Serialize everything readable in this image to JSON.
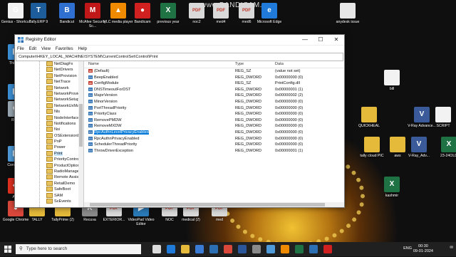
{
  "recording_watermark": "www.BANDICAM.com",
  "desktop_icons": [
    {
      "label": "Genius - Shortcut",
      "icon": "genius-icon",
      "color": "#f2f2f2"
    },
    {
      "label": "Tally.ERP 9",
      "icon": "tally-icon",
      "color": "#1d5d9b"
    },
    {
      "label": "Bandicut",
      "icon": "bandicut-icon",
      "color": "#2f6fd0"
    },
    {
      "label": "McAfee Security Sc...",
      "icon": "mcafee-icon",
      "color": "#c01818"
    },
    {
      "label": "VLC media player",
      "icon": "vlc-icon",
      "color": "#f08a00"
    },
    {
      "label": "Bandicam",
      "icon": "bandicam-icon",
      "color": "#d02020"
    },
    {
      "label": "previous year",
      "icon": "excel-icon",
      "color": "#1f7244"
    },
    {
      "label": "noc2",
      "icon": "pdf-icon",
      "color": "#d9d9d9"
    },
    {
      "label": "med4",
      "icon": "pdf-icon",
      "color": "#d9d9d9"
    },
    {
      "label": "med6",
      "icon": "pdf-icon",
      "color": "#d9d9d9"
    },
    {
      "label": "Microsoft Edge",
      "icon": "edge-icon",
      "color": "#1f7ad9"
    },
    {
      "label": "anydesk issue",
      "icon": "file-icon",
      "color": "#e6e6e6"
    },
    {
      "label": "This PC",
      "icon": "pc-icon",
      "color": "#3c8fd6"
    },
    {
      "label": "Netw",
      "icon": "network-icon",
      "color": "#3c8fd6"
    },
    {
      "label": "Recy",
      "icon": "recycle-icon",
      "color": "#9aa8b3"
    },
    {
      "label": "Contr Pan",
      "icon": "control-panel-icon",
      "color": "#4f9bd9"
    },
    {
      "label": "Any",
      "icon": "anydesk-icon",
      "color": "#e03020"
    },
    {
      "label": "bill",
      "icon": "file-icon",
      "color": "#f2f2f2"
    },
    {
      "label": "QUICKHEAL",
      "icon": "folder-icon",
      "color": "#e5b93a"
    },
    {
      "label": "V-Ray Advance...",
      "icon": "vray-icon",
      "color": "#3a5a9a"
    },
    {
      "label": "SCRIPT",
      "icon": "file-icon",
      "color": "#f2f2f2"
    },
    {
      "label": "tally cloud PIC",
      "icon": "folder-icon",
      "color": "#e5b93a"
    },
    {
      "label": "aws",
      "icon": "folder-icon",
      "color": "#e5b93a"
    },
    {
      "label": "V-Ray_Adv...",
      "icon": "vray-icon",
      "color": "#3a5a9a"
    },
    {
      "label": "23-24OLD",
      "icon": "excel-icon",
      "color": "#1f7244"
    },
    {
      "label": "kashmir",
      "icon": "excel-icon",
      "color": "#1f7244"
    },
    {
      "label": "Google Chrome",
      "icon": "chrome-icon",
      "color": "#d9483b"
    },
    {
      "label": "TALLY",
      "icon": "folder-icon",
      "color": "#e5b93a"
    },
    {
      "label": "TallyPrime (2)",
      "icon": "folder-icon",
      "color": "#e5b93a"
    },
    {
      "label": "Recuva",
      "icon": "recuva-icon",
      "color": "#8a8a8a"
    },
    {
      "label": "EXTERIOR...",
      "icon": "pdf-icon",
      "color": "#d9d9d9"
    },
    {
      "label": "VideoPad Video Editor",
      "icon": "videopad-icon",
      "color": "#2a7ab8"
    },
    {
      "label": "NOC",
      "icon": "pdf-icon",
      "color": "#d9d9d9"
    },
    {
      "label": "medical (2)",
      "icon": "pdf-icon",
      "color": "#d9d9d9"
    },
    {
      "label": "med",
      "icon": "pdf-icon",
      "color": "#d9d9d9"
    }
  ],
  "window": {
    "title": "Registry Editor",
    "menu": [
      "File",
      "Edit",
      "View",
      "Favorites",
      "Help"
    ],
    "address": "Computer\\HKEY_LOCAL_MACHINE\\SYSTEM\\CurrentControlSet\\Control\\Print",
    "tree": [
      {
        "label": "NetDiagFx",
        "selected": false
      },
      {
        "label": "NetDrivers",
        "selected": false
      },
      {
        "label": "NetProvision",
        "selected": false
      },
      {
        "label": "NetTrace",
        "selected": false
      },
      {
        "label": "Network",
        "selected": false
      },
      {
        "label": "NetworkProvic",
        "selected": false
      },
      {
        "label": "NetworkSetup",
        "selected": false
      },
      {
        "label": "NetworkUxMa",
        "selected": false
      },
      {
        "label": "Nls",
        "selected": false
      },
      {
        "label": "NodeInterface",
        "selected": false
      },
      {
        "label": "Notifications",
        "selected": false
      },
      {
        "label": "Nsi",
        "selected": false
      },
      {
        "label": "OSExtensionD",
        "selected": false
      },
      {
        "label": "PnP",
        "selected": false
      },
      {
        "label": "Power",
        "selected": false
      },
      {
        "label": "Print",
        "selected": true
      },
      {
        "label": "PriorityContro",
        "selected": false
      },
      {
        "label": "ProductOptior",
        "selected": false
      },
      {
        "label": "RadioManager",
        "selected": false
      },
      {
        "label": "Remote Assist",
        "selected": false
      },
      {
        "label": "RetailDemo",
        "selected": false
      },
      {
        "label": "SafeBoot",
        "selected": false
      },
      {
        "label": "SAM",
        "selected": false
      },
      {
        "label": "ScEvents",
        "selected": false
      }
    ],
    "columns": {
      "name": "Name",
      "type": "Type",
      "data": "Data"
    },
    "values": [
      {
        "name": "(Default)",
        "type": "REG_SZ",
        "data": "(value not set)",
        "kind": "sz",
        "selected": false
      },
      {
        "name": "BeepEnabled",
        "type": "REG_DWORD",
        "data": "0x00000000 (0)",
        "kind": "dw",
        "selected": false
      },
      {
        "name": "ConfigModule",
        "type": "REG_SZ",
        "data": "PrintConfig.dll",
        "kind": "sz",
        "selected": false
      },
      {
        "name": "DNSTimeoutForDST",
        "type": "REG_DWORD",
        "data": "0x00000001 (1)",
        "kind": "dw",
        "selected": false
      },
      {
        "name": "MajorVersion",
        "type": "REG_DWORD",
        "data": "0x00000002 (2)",
        "kind": "dw",
        "selected": false
      },
      {
        "name": "MinorVersion",
        "type": "REG_DWORD",
        "data": "0x00000000 (0)",
        "kind": "dw",
        "selected": false
      },
      {
        "name": "PortThreadPriority",
        "type": "REG_DWORD",
        "data": "0x00000000 (0)",
        "kind": "dw",
        "selected": false
      },
      {
        "name": "PriorityClass",
        "type": "REG_DWORD",
        "data": "0x00000000 (0)",
        "kind": "dw",
        "selected": false
      },
      {
        "name": "RemovePMDW",
        "type": "REG_DWORD",
        "data": "0x00000000 (0)",
        "kind": "dw",
        "selected": false
      },
      {
        "name": "RemoveMXDW",
        "type": "REG_DWORD",
        "data": "0x00000000 (0)",
        "kind": "dw",
        "selected": false
      },
      {
        "name": "RpcAuthnLevelPrivacyEnabled",
        "type": "REG_DWORD",
        "data": "0x00000000 (0)",
        "kind": "dw",
        "selected": true
      },
      {
        "name": "RpcAuthnPrivacyEnabled",
        "type": "REG_DWORD",
        "data": "0x00000000 (0)",
        "kind": "dw",
        "selected": false
      },
      {
        "name": "SchedulerThreadPriority",
        "type": "REG_DWORD",
        "data": "0x00000000 (0)",
        "kind": "dw",
        "selected": false
      },
      {
        "name": "ThrowDriverException",
        "type": "REG_DWORD",
        "data": "0x00000001 (1)",
        "kind": "dw",
        "selected": false
      }
    ]
  },
  "taskbar": {
    "search_placeholder": "Type here to search",
    "apps": [
      "task-view-icon",
      "edge-icon",
      "file-explorer-icon",
      "store-icon",
      "mail-icon",
      "chrome-icon",
      "word-icon",
      "settings-icon",
      "photos-icon",
      "vlc-icon",
      "excel-icon",
      "regedit-icon",
      "bandicam-icon"
    ],
    "tray": {
      "language": "ENG",
      "time": "00:30",
      "date": "09-01-2024"
    }
  },
  "colors": {
    "selection": "#0078d7",
    "taskbar": "#202020",
    "tree_selection": "#cce8ff"
  }
}
